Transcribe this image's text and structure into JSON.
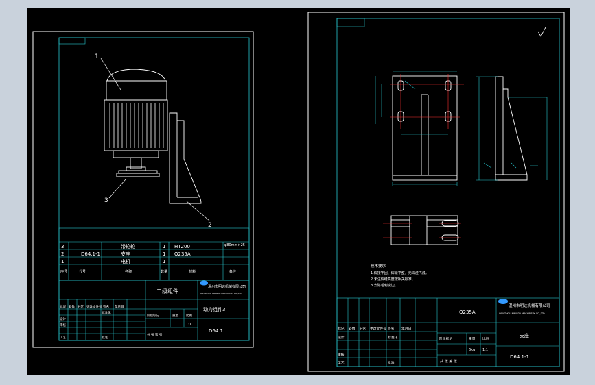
{
  "window": {
    "background": "#c9d2dc",
    "canvas": "#000000"
  },
  "colors": {
    "frame": "#ffffff",
    "cyan": "#27c9d1",
    "part": "#ffffff",
    "red": "#ff3030",
    "logo": "#3399ff"
  },
  "left_sheet": {
    "callouts": [
      "1",
      "3",
      "2"
    ],
    "bom_rows": [
      {
        "no": "3",
        "code": "",
        "name": "带轮轮",
        "qty": "1",
        "material": "HT200",
        "note": "φ80mm×25"
      },
      {
        "no": "2",
        "code": "D64.1-1",
        "name": "支座",
        "qty": "1",
        "material": "Q235A",
        "note": ""
      },
      {
        "no": "1",
        "code": "",
        "name": "电机",
        "qty": "1",
        "material": "",
        "note": ""
      }
    ],
    "bom_header": [
      "序号",
      "代号",
      "名称",
      "数量",
      "材料",
      "备注"
    ],
    "title_block": {
      "company": "温州市明达机械有限公司",
      "company_en": "WENZHOU MINGDA MACHINERY CO.,LTD",
      "material": "二级组件",
      "drawing_name": "动力组件3",
      "drawing_no": "D64.1",
      "row_labels": [
        "标记",
        "处数",
        "分区",
        "更改文件号",
        "签名",
        "年月日"
      ],
      "left_labels": [
        "设计",
        "审核",
        "工艺",
        "标准化",
        "批准"
      ],
      "stage_labels": [
        "阶段标记",
        "重量",
        "比例"
      ],
      "scale": "1:1",
      "sheets": "共   张   第   张"
    }
  },
  "right_sheet": {
    "notes": [
      "技术要求",
      "1.焊接牢固、焊缝平整，无焊渣飞溅。",
      "2.未注焊缝高度按相关标准。",
      "3.去除毛刺锐边。"
    ],
    "title_block": {
      "company": "温州市明达机械有限公司",
      "company_en": "WENZHOU MINGDA MACHINERY CO.,LTD",
      "material": "Q235A",
      "drawing_name": "支座",
      "drawing_no": "D64.1-1",
      "row_labels": [
        "标记",
        "处数",
        "分区",
        "更改文件号",
        "签名",
        "年月日"
      ],
      "left_labels": [
        "设计",
        "审核",
        "工艺"
      ],
      "standard_label": "标准化",
      "approve_label": "批准",
      "stage_labels": [
        "阶段标记",
        "重量",
        "比例"
      ],
      "weight": "6kg",
      "scale": "1:1",
      "sheets": "共  张  第  张"
    }
  }
}
